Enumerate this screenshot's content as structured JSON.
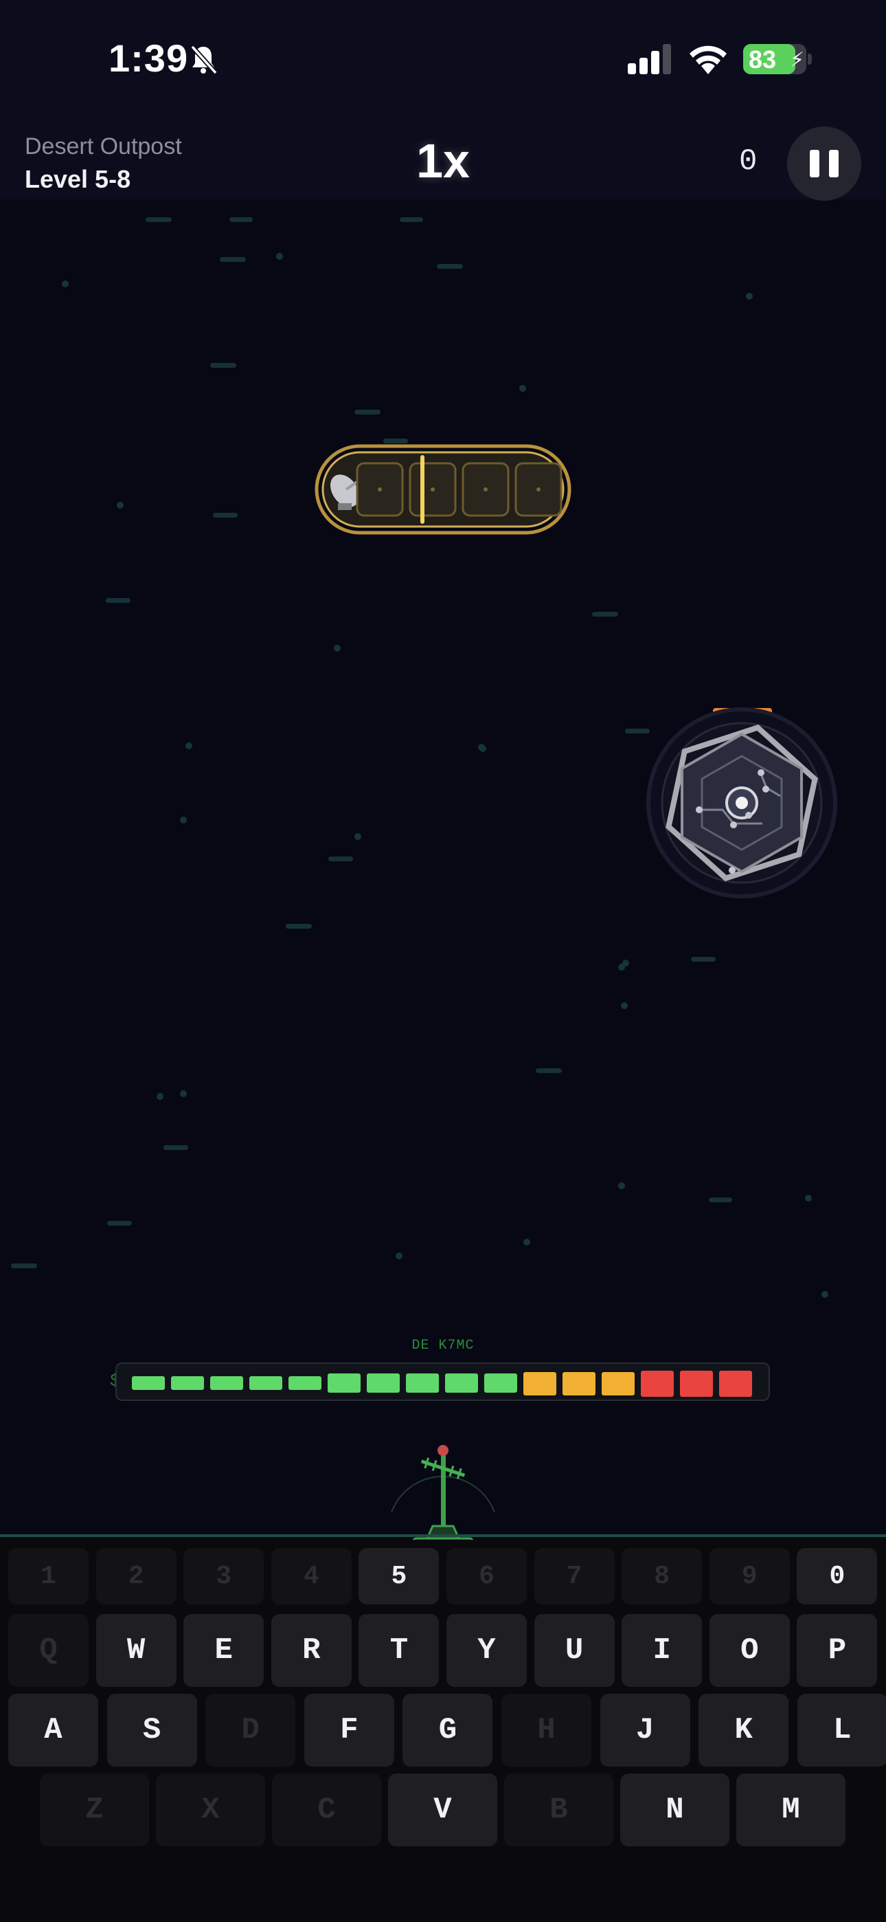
{
  "status_bar": {
    "time": "1:39",
    "battery_percent": "83",
    "battery_level": 0.83,
    "icons": [
      "bell-muted-icon",
      "signal-icon",
      "wifi-icon",
      "battery-charging-icon"
    ]
  },
  "header": {
    "location": "Desert Outpost",
    "level": "Level 5-8",
    "speed": "1x",
    "score": "0",
    "pause_icon": "pause-icon"
  },
  "game": {
    "signal_capsule": {
      "icon": "satellite-dish-icon",
      "slots": 4,
      "active_slot": 2
    },
    "enemy": {
      "icon": "hexagon-core-icon",
      "health": 1.0,
      "health_color": "#ea8732"
    },
    "antenna": {
      "callsign": "DE K7MC",
      "icon": "antenna-tower-icon"
    },
    "power_meter": {
      "symbol": "$",
      "segments": [
        "green",
        "green",
        "green",
        "green",
        "green",
        "green",
        "green",
        "green",
        "green",
        "green",
        "yellow",
        "yellow",
        "yellow",
        "red",
        "red",
        "red"
      ]
    }
  },
  "colors": {
    "background": "#070814",
    "green": "#5fd96a",
    "yellow": "#f2b033",
    "red": "#e9443f",
    "capsule_gold": "#c9a24e"
  },
  "keyboard": {
    "rows": [
      [
        {
          "k": "1",
          "on": false
        },
        {
          "k": "2",
          "on": false
        },
        {
          "k": "3",
          "on": false
        },
        {
          "k": "4",
          "on": false
        },
        {
          "k": "5",
          "on": true
        },
        {
          "k": "6",
          "on": false
        },
        {
          "k": "7",
          "on": false
        },
        {
          "k": "8",
          "on": false
        },
        {
          "k": "9",
          "on": false
        },
        {
          "k": "0",
          "on": true
        }
      ],
      [
        {
          "k": "Q",
          "on": false
        },
        {
          "k": "W",
          "on": true
        },
        {
          "k": "E",
          "on": true
        },
        {
          "k": "R",
          "on": true
        },
        {
          "k": "T",
          "on": true
        },
        {
          "k": "Y",
          "on": true
        },
        {
          "k": "U",
          "on": true
        },
        {
          "k": "I",
          "on": true
        },
        {
          "k": "O",
          "on": true
        },
        {
          "k": "P",
          "on": true
        }
      ],
      [
        {
          "k": "A",
          "on": true
        },
        {
          "k": "S",
          "on": true
        },
        {
          "k": "D",
          "on": false
        },
        {
          "k": "F",
          "on": true
        },
        {
          "k": "G",
          "on": true
        },
        {
          "k": "H",
          "on": false
        },
        {
          "k": "J",
          "on": true
        },
        {
          "k": "K",
          "on": true
        },
        {
          "k": "L",
          "on": true
        }
      ],
      [
        {
          "k": "Z",
          "on": false
        },
        {
          "k": "X",
          "on": false
        },
        {
          "k": "C",
          "on": false
        },
        {
          "k": "V",
          "on": true
        },
        {
          "k": "B",
          "on": false
        },
        {
          "k": "N",
          "on": true
        },
        {
          "k": "M",
          "on": true
        }
      ]
    ]
  }
}
